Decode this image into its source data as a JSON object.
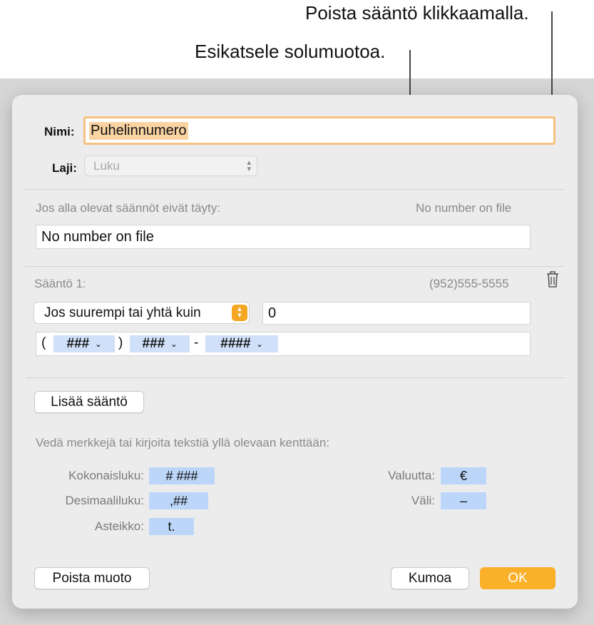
{
  "callouts": {
    "delete_rule": "Poista sääntö klikkaamalla.",
    "preview_format": "Esikatsele solumuotoa."
  },
  "dialog": {
    "name_label": "Nimi:",
    "name_value": "Puhelinnumero",
    "type_label": "Laji:",
    "type_value": "Luku",
    "fallback_label": "Jos alla olevat säännöt eivät täyty:",
    "fallback_preview": "No number on file",
    "fallback_value": "No number on file",
    "rule": {
      "title": "Sääntö 1:",
      "preview": "(952)555-5555",
      "condition": "Jos suurempi tai yhtä kuin",
      "condition_value": "0",
      "format": {
        "open_paren": "(",
        "token1": "###",
        "close_paren": ")",
        "token2": "###",
        "dash": "-",
        "token3": "####"
      }
    },
    "add_rule_button": "Lisää sääntö",
    "hint": "Vedä merkkejä tai kirjoita tekstiä yllä olevaan kenttään:",
    "palette": {
      "integer_label": "Kokonaisluku:",
      "integer_chip": "# ###",
      "decimal_label": "Desimaaliluku:",
      "decimal_chip": ",##",
      "scale_label": "Asteikko:",
      "scale_chip": "t.",
      "currency_label": "Valuutta:",
      "currency_chip": "€",
      "spacing_label": "Väli:",
      "spacing_chip": "–"
    },
    "delete_format_button": "Poista muoto",
    "cancel_button": "Kumoa",
    "ok_button": "OK"
  },
  "colors": {
    "accent_orange": "#fbb02a",
    "token_blue": "#cfe0f8",
    "name_highlight": "#f9d3a2"
  },
  "icons": {
    "trash": "trash-icon",
    "updown": "chevron-updown-icon",
    "chevron": "chevron-down-icon"
  }
}
